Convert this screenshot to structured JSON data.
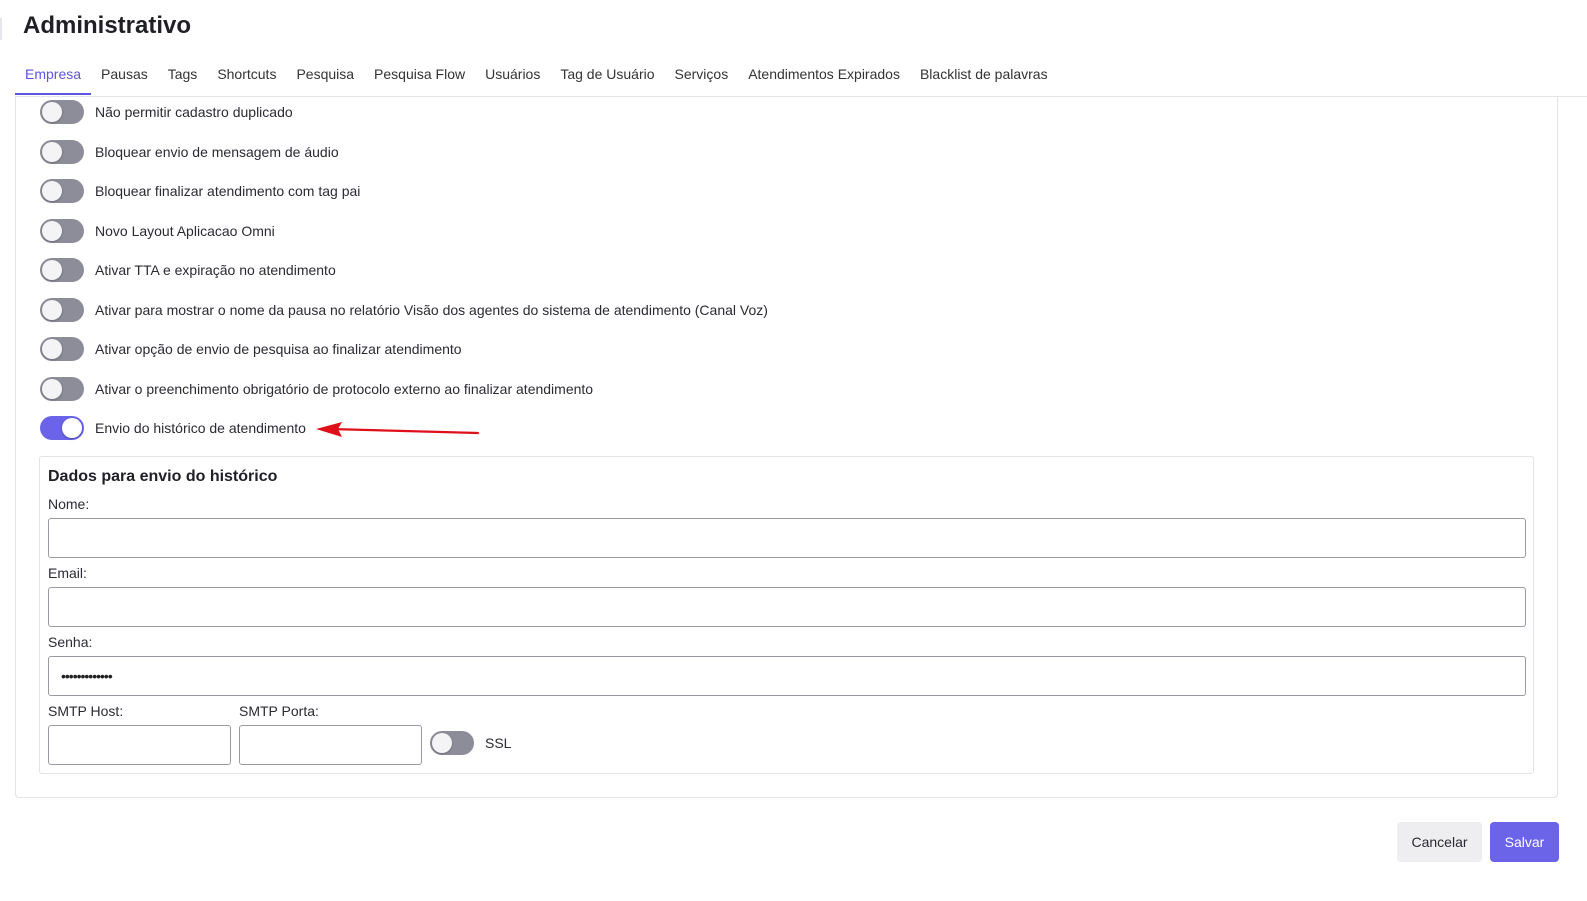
{
  "page": {
    "title": "Administrativo"
  },
  "tabs": [
    {
      "label": "Empresa",
      "active": true
    },
    {
      "label": "Pausas",
      "active": false
    },
    {
      "label": "Tags",
      "active": false
    },
    {
      "label": "Shortcuts",
      "active": false
    },
    {
      "label": "Pesquisa",
      "active": false
    },
    {
      "label": "Pesquisa Flow",
      "active": false
    },
    {
      "label": "Usuários",
      "active": false
    },
    {
      "label": "Tag de Usuário",
      "active": false
    },
    {
      "label": "Serviços",
      "active": false
    },
    {
      "label": "Atendimentos Expirados",
      "active": false
    },
    {
      "label": "Blacklist de palavras",
      "active": false
    }
  ],
  "settings": [
    {
      "label": "Não permitir cadastro duplicado",
      "enabled": false
    },
    {
      "label": "Bloquear envio de mensagem de áudio",
      "enabled": false
    },
    {
      "label": "Bloquear finalizar atendimento com tag pai",
      "enabled": false
    },
    {
      "label": "Novo Layout Aplicacao Omni",
      "enabled": false
    },
    {
      "label": "Ativar TTA e expiração no atendimento",
      "enabled": false
    },
    {
      "label": "Ativar para mostrar o nome da pausa no relatório Visão dos agentes do sistema de atendimento (Canal Voz)",
      "enabled": false
    },
    {
      "label": "Ativar opção de envio de pesquisa ao finalizar atendimento",
      "enabled": false
    },
    {
      "label": "Ativar o preenchimento obrigatório de protocolo externo ao finalizar atendimento",
      "enabled": false
    },
    {
      "label": "Envio do histórico de atendimento",
      "enabled": true
    }
  ],
  "history": {
    "title": "Dados para envio do histórico",
    "nome_label": "Nome:",
    "nome_value": "",
    "email_label": "Email:",
    "email_value": "",
    "senha_label": "Senha:",
    "senha_value": "•••••••••••••",
    "smtp_host_label": "SMTP Host:",
    "smtp_host_value": "",
    "smtp_porta_label": "SMTP Porta:",
    "smtp_porta_value": "",
    "ssl_label": "SSL",
    "ssl_enabled": false
  },
  "actions": {
    "cancel": "Cancelar",
    "save": "Salvar"
  },
  "colors": {
    "accent": "#6b63e8",
    "switch_off": "#8d8d99",
    "annotation_arrow": "#e0101a"
  },
  "annotation": {
    "arrow_target": "Envio do histórico de atendimento"
  }
}
